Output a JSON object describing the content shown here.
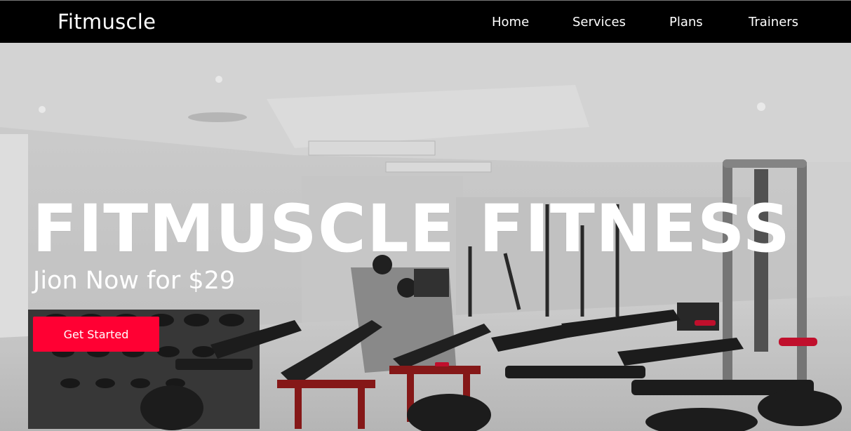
{
  "nav": {
    "brand": "Fitmuscle",
    "links": [
      "Home",
      "Services",
      "Plans",
      "Trainers"
    ]
  },
  "hero": {
    "title": "FITMUSCLE FITNESS",
    "subtitle": "Jion Now for $29",
    "cta_label": "Get Started"
  },
  "colors": {
    "nav_bg": "#000000",
    "accent": "#ff0033",
    "text": "#ffffff"
  }
}
